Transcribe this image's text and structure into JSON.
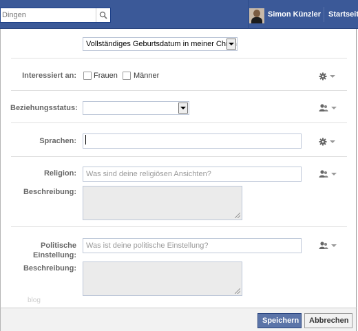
{
  "header": {
    "search_value": "Dingen",
    "user_name": "Simon Künzler",
    "home_label": "Startseite"
  },
  "form": {
    "birthday_visibility": "Vollständiges Geburtsdatum in meiner Chronik anzeigen",
    "interested_in": {
      "label": "Interessiert an:",
      "options": [
        "Frauen",
        "Männer"
      ]
    },
    "relationship": {
      "label": "Beziehungsstatus:",
      "value": ""
    },
    "languages": {
      "label": "Sprachen:",
      "value": ""
    },
    "religion": {
      "label": "Religion:",
      "placeholder": "Was sind deine religiösen Ansichten?",
      "description_label": "Beschreibung:"
    },
    "politics": {
      "label_line1": "Politische",
      "label_line2": "Einstellung:",
      "placeholder": "Was ist deine politische Einstellung?",
      "description_label": "Beschreibung:"
    },
    "watermark": "blog"
  },
  "footer": {
    "save_label": "Speichern",
    "cancel_label": "Abbrechen"
  },
  "icons": {
    "search": "search-icon",
    "gear": "gear-icon",
    "people": "people-icon"
  },
  "colors": {
    "topbar": "#3b5998",
    "save_button": "#5b74a8"
  }
}
